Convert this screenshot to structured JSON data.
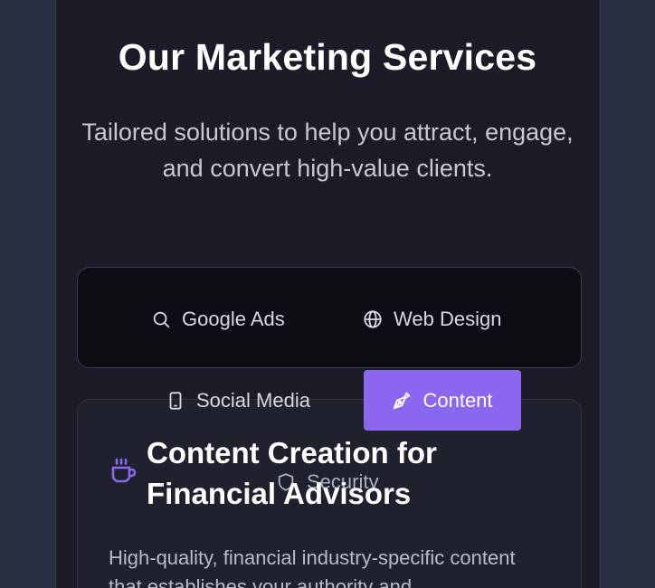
{
  "header": {
    "title": "Our Marketing Services",
    "subtitle": "Tailored solutions to help you attract, engage, and convert high-value clients."
  },
  "tabs": [
    {
      "label": "Google Ads",
      "icon": "search-icon",
      "active": false
    },
    {
      "label": "Web Design",
      "icon": "globe-icon",
      "active": false
    },
    {
      "label": "Social Media",
      "icon": "smartphone-icon",
      "active": false
    },
    {
      "label": "Content",
      "icon": "pen-tool-icon",
      "active": true
    },
    {
      "label": "Security",
      "icon": "shield-icon",
      "active": false
    }
  ],
  "card": {
    "icon": "coffee-cup-icon",
    "title": "Content Creation for Financial Advisors",
    "description": "High-quality, financial industry-specific content that establishes your authority and"
  },
  "colors": {
    "accent": "#8b67f0",
    "background": "#1b1c27",
    "outer": "#2a2f43"
  }
}
